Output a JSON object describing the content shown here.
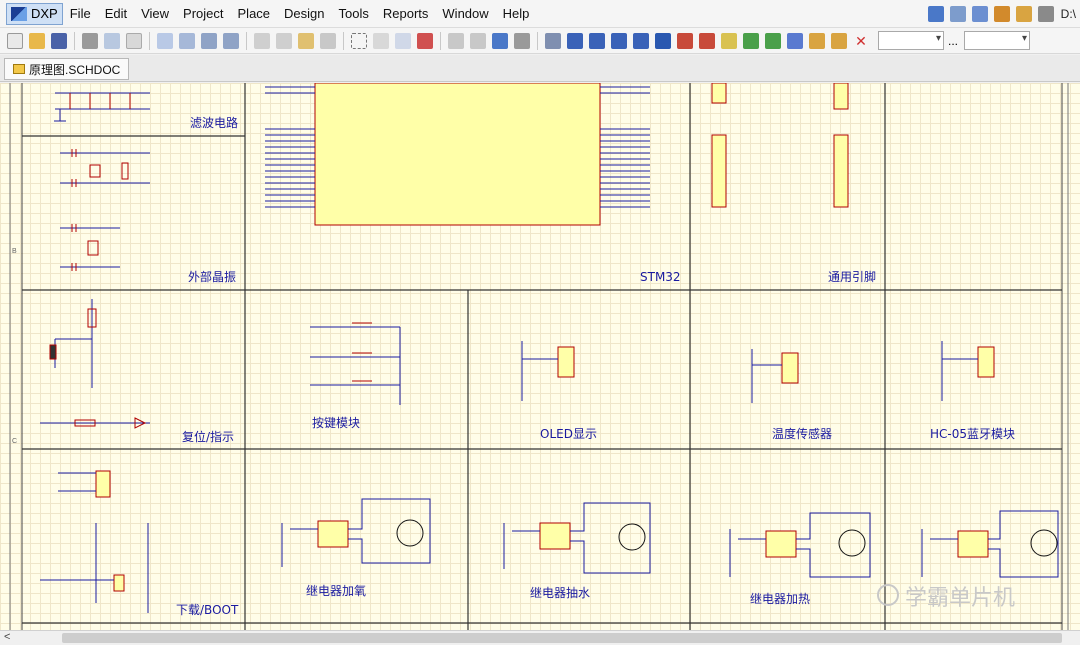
{
  "app": {
    "logo_label": "DXP",
    "path": "D:\\"
  },
  "menu": [
    "File",
    "Edit",
    "View",
    "Project",
    "Place",
    "Design",
    "Tools",
    "Reports",
    "Window",
    "Help"
  ],
  "tab": {
    "label": "原理图.SCHDOC"
  },
  "blocks": {
    "filter": "滤波电路",
    "crystal": "外部晶振",
    "stm32": "STM32",
    "pins": "通用引脚",
    "reset": "复位/指示",
    "keys": "按键模块",
    "oled": "OLED显示",
    "temp": "温度传感器",
    "bt": "HC-05蓝牙模块",
    "download": "下载/BOOT",
    "relay1": "继电器加氧",
    "relay2": "继电器抽水",
    "relay3": "继电器加热"
  },
  "watermark": "学霸单片机",
  "colors": {
    "canvas": "#fffde8",
    "ic_fill": "#ffffa8",
    "wire": "#1a1aa0",
    "net_red": "#b00000"
  }
}
